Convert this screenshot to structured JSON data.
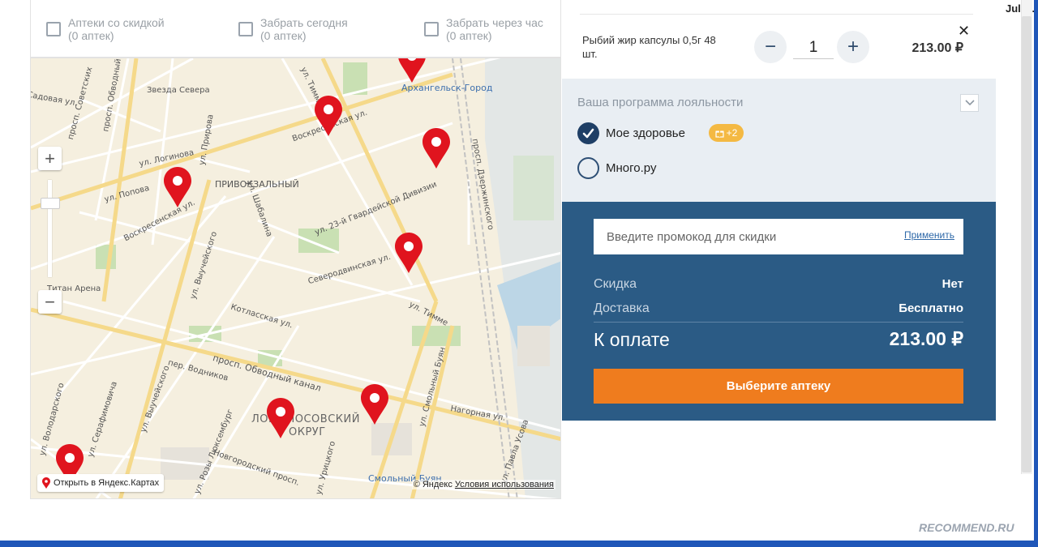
{
  "filters": [
    {
      "label": "Аптеки со скидкой",
      "count": "(0 аптек)",
      "checked": false
    },
    {
      "label": "Забрать сегодня",
      "count": "(0 аптек)",
      "checked": false
    },
    {
      "label": "Забрать через час",
      "count": "(0 аптек)",
      "checked": false
    }
  ],
  "map": {
    "labels": {
      "zvezda": "Звезда Севера",
      "arkh_gorod": "Архангельск-Город",
      "privokz": "ПРИВОКЗАЛЬНЫЙ",
      "titan": "Титан Арена",
      "lomonos_1": "ЛОМОНОСОВСКИЙ",
      "lomonos_2": "ОКРУГ",
      "smolny": "Смольный Буян",
      "voskr1": "Воскресенская ул.",
      "voskr2": "Воскресенская ул.",
      "gvard": "ул. 23-й Гвардейской Дивизии",
      "timme1": "ул. Тимме",
      "timme2": "ул. Тимме",
      "obvodny": "просп. Обводный канал",
      "obvodny_top": "просп. Обводный",
      "sovetskih": "просп. Советских",
      "dzerzh": "просп. Дзержинского",
      "loginova": "ул. Логинова",
      "popova": "ул. Попова",
      "shabalina": "ул. Шабалина",
      "vychegodsk1": "ул. Выучейского",
      "vychegodsk2": "ул. Выучейского",
      "severodv": "Северодвинская ул.",
      "kotlas": "Котласская ул.",
      "vodnikov": "пер. Водников",
      "uritskogo": "ул. Урицкого",
      "smolny_buyan_ul": "ул. Смольный Буян",
      "nagornaya": "Нагорная ул.",
      "lyuksemburg": "ул. Розы Люксембург",
      "novgorod": "Новгородский просп.",
      "serafim": "ул. Серафимовича",
      "volodarsk": "ул. Володарского",
      "prirova": "ул. Прирова",
      "usova": "ул. Павла Усова",
      "lodochnaya": "Садовая ул."
    },
    "open_in_maps": "Открыть в Яндекс.Картах",
    "copyright": "© Яндекс",
    "terms": "Условия использования",
    "zoom_in": "+",
    "zoom_out": "−",
    "pin_color": "#e0141e"
  },
  "cart": {
    "product_name": "Рыбий жир капсулы 0,5г 48 шт.",
    "minus": "−",
    "plus": "+",
    "quantity": "1",
    "price": "213.00 ₽",
    "remove": "✕"
  },
  "loyalty": {
    "title": "Ваша программа лояльности",
    "programs": [
      {
        "label": "Мое здоровье",
        "selected": true,
        "bonus": "+2"
      },
      {
        "label": "Много.ру",
        "selected": false
      }
    ]
  },
  "summary": {
    "promo_placeholder": "Введите промокод для скидки",
    "promo_apply": "Применить",
    "discount_label": "Скидка",
    "discount_value": "Нет",
    "delivery_label": "Доставка",
    "delivery_value": "Бесплатно",
    "total_label": "К оплате",
    "total_value": "213.00 ₽",
    "cta": "Выберите аптеку"
  },
  "user": "Jul.G.",
  "watermark": "RECOMMEND.RU",
  "colors": {
    "brand_blue": "#2b5b85",
    "cta_orange": "#ef7c1e",
    "loyalty_bg": "#e9eef3",
    "badge": "#f4b943"
  }
}
